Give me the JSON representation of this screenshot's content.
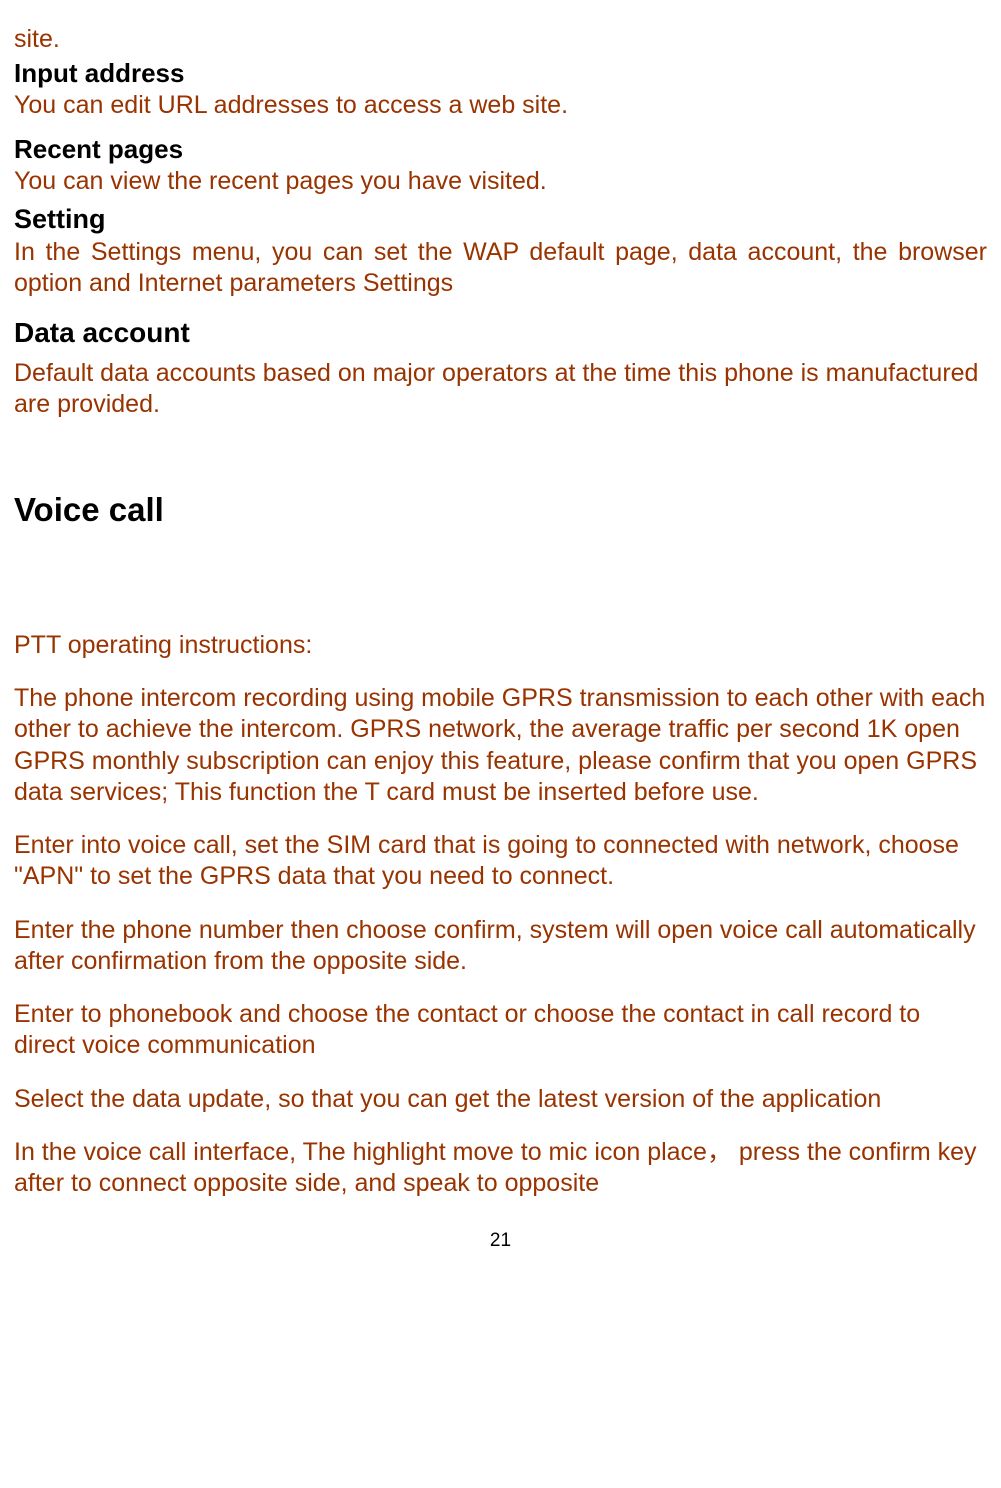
{
  "fragment_top": "site.",
  "inputAddress": {
    "heading": "Input address",
    "text": "You can edit URL addresses to access a web site."
  },
  "recentPages": {
    "heading": "Recent pages",
    "text": "You can view the recent pages you have visited."
  },
  "setting": {
    "heading": "Setting",
    "text": "In the Settings menu, you can set the WAP default page, data account, the browser option and Internet parameters Settings"
  },
  "dataAccount": {
    "heading": "Data account",
    "text": "Default data accounts based on major operators at the time this phone is manufactured are provided."
  },
  "voiceCall": {
    "heading": "Voice call",
    "p1": "PTT operating instructions:",
    "p2": "The phone intercom recording using mobile GPRS transmission to each other with each other to achieve the intercom. GPRS network, the average traffic per second 1K open GPRS monthly subscription can enjoy this feature, please confirm that you open GPRS data services; This function the T card must be inserted before use.",
    "p3": "Enter into voice call, set the SIM card that is going to connected with network, choose \"APN\" to set the GPRS data that you need to connect.",
    "p4": "Enter the phone number then choose confirm, system will open voice call automatically after confirmation from the opposite side.",
    "p5": "Enter to phonebook and choose the contact or choose the contact in call record to direct voice communication",
    "p6": "Select the data update, so that you can get the latest version of the application",
    "p7": "In the voice call interface, The highlight move to mic icon place， press the confirm key after to connect opposite side, and speak to opposite"
  },
  "pageNumber": "21"
}
